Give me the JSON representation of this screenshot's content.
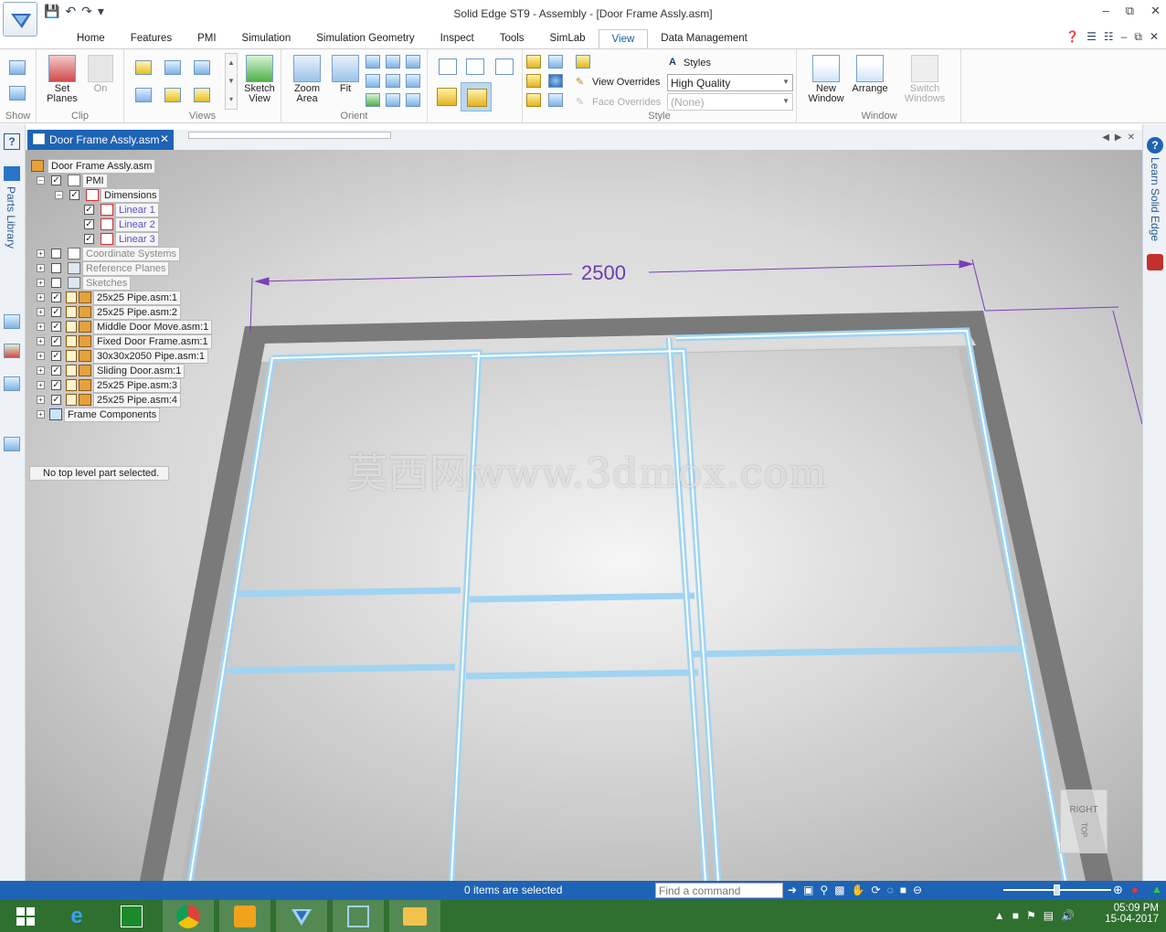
{
  "window": {
    "title": "Solid Edge ST9 - Assembly - [Door Frame Assly.asm]"
  },
  "ribbon_tabs": [
    "Home",
    "Features",
    "PMI",
    "Simulation",
    "Simulation Geometry",
    "Inspect",
    "Tools",
    "SimLab",
    "View",
    "Data Management"
  ],
  "active_tab": "View",
  "ribbon": {
    "show_label": "Show",
    "set_planes_line1": "Set",
    "set_planes_line2": "Planes",
    "on_label": "On",
    "clip_group": "Clip",
    "views_group": "Views",
    "sketch_view_line1": "Sketch",
    "sketch_view_line2": "View",
    "zoom_area_line1": "Zoom",
    "zoom_area_line2": "Area",
    "fit_label": "Fit",
    "orient_group": "Orient",
    "styles_label": "Styles",
    "view_overrides_label": "View Overrides",
    "view_overrides_value": "High Quality",
    "face_overrides_label": "Face Overrides",
    "face_overrides_value": "(None)",
    "style_group": "Style",
    "new_window_line1": "New",
    "new_window_line2": "Window",
    "arrange_label": "Arrange",
    "window_group": "Window",
    "switch_windows_line1": "Switch",
    "switch_windows_line2": "Windows"
  },
  "sidebar": {
    "parts_library": "Parts Library",
    "learn": "Learn Solid Edge"
  },
  "document_tab": "Door Frame Assly.asm",
  "tree": {
    "root": "Door Frame Assly.asm",
    "pmi": "PMI",
    "dimensions": "Dimensions",
    "linear1": "Linear 1",
    "linear2": "Linear 2",
    "linear3": "Linear 3",
    "coordinate_systems": "Coordinate Systems",
    "reference_planes": "Reference Planes",
    "sketches": "Sketches",
    "parts": [
      "25x25 Pipe.asm:1",
      "25x25 Pipe.asm:2",
      "Middle Door Move.asm:1",
      "Fixed Door Frame.asm:1",
      "30x30x2050 Pipe.asm:1",
      "Sliding Door.asm:1",
      "25x25 Pipe.asm:3",
      "25x25 Pipe.asm:4"
    ],
    "frame_components": "Frame Components"
  },
  "selection_message": "No top level part selected.",
  "dimension_value": "2500",
  "watermark": "莫西网www.3dmox.com",
  "viewcube": {
    "right": "RIGHT",
    "top": "TOP"
  },
  "statusbar": {
    "selected": "0 items are selected",
    "find_placeholder": "Find a command"
  },
  "taskbar": {
    "time": "05:09 PM",
    "date": "15-04-2017"
  }
}
